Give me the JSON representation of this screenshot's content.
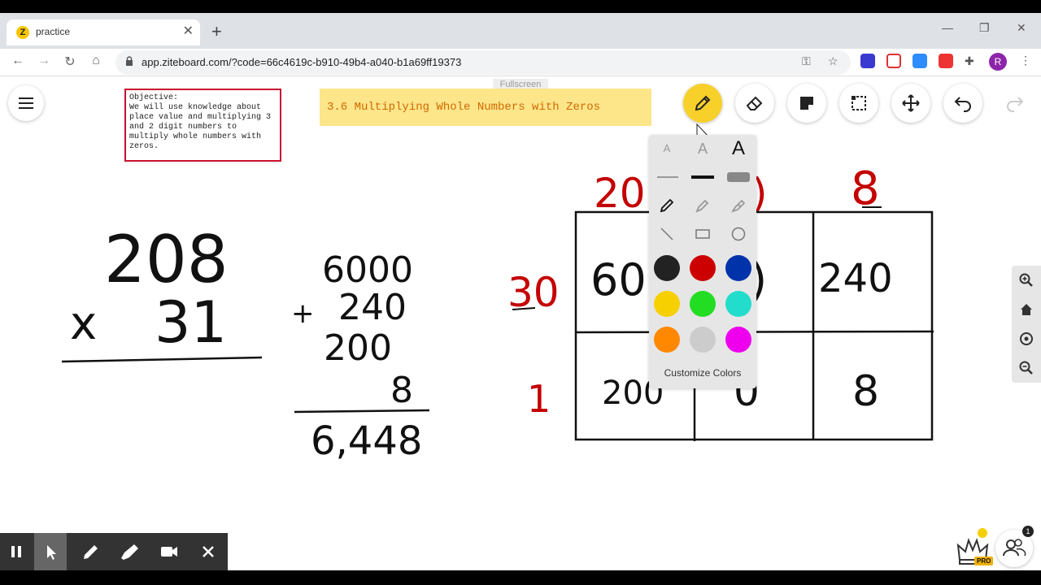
{
  "browser": {
    "tab_title": "practice",
    "tab_favicon_letter": "Z",
    "url": "app.ziteboard.com/?code=66c4619c-b910-49b4-a040-b1a69ff19373",
    "profile_initial": "R",
    "icons": [
      "back-icon",
      "forward-icon",
      "reload-icon",
      "home-icon",
      "lock-icon",
      "key-icon",
      "star-icon",
      "extensions-icon",
      "menu-dots-icon"
    ]
  },
  "board": {
    "fullscreen_label": "Fullscreen",
    "objective_label": "Objective:",
    "objective_text": "We will use knowledge about place value and multiplying 3 and 2 digit numbers to multiply whole numbers with zeros.",
    "title_note": "3.6 Multiplying Whole Numbers with Zeros",
    "tools": [
      "pen-icon",
      "eraser-icon",
      "sticky-note-icon",
      "selection-icon",
      "move-icon",
      "undo-icon",
      "redo-icon"
    ],
    "palette": {
      "font_sizes": [
        "A",
        "A",
        "A"
      ],
      "customize_label": "Customize Colors",
      "colors": [
        "#222222",
        "#cc0000",
        "#0033aa",
        "#f7d000",
        "#22dd22",
        "#22ddcc",
        "#ff8800",
        "#cccccc",
        "#ee00ee"
      ]
    },
    "colors": {
      "accent": "#f8d02a",
      "objective_border": "#c8102e",
      "note_bg": "#fde58a",
      "note_text": "#d06a00",
      "marker_red": "#c40000"
    },
    "handwriting": {
      "problem_top": "208",
      "problem_times": "x",
      "problem_bottom": "31",
      "sum_plus": "+",
      "sum_lines": [
        "6000",
        "240",
        "200",
        "8"
      ],
      "sum_total": "6,448",
      "grid_col_top_left": "20",
      "grid_col_top_right": "8",
      "grid_row_left_top": "30",
      "grid_row_left_bottom": "1",
      "cell_tl": "60",
      "cell_tr": "240",
      "cell_bl": "200",
      "cell_bm": "0",
      "cell_br": "8"
    },
    "unread_users": "1",
    "pro_label": "PRO"
  }
}
